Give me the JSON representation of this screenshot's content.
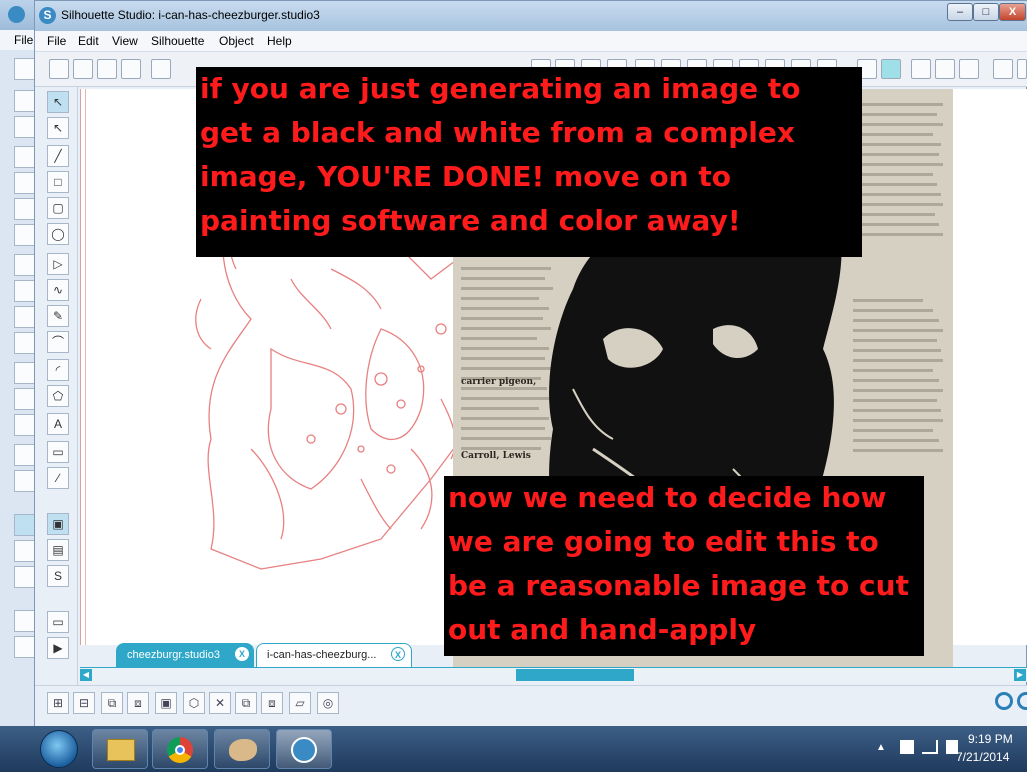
{
  "back_window": {
    "menu_label": "File"
  },
  "window": {
    "title": "Silhouette Studio: i-can-has-cheezburger.studio3",
    "logo_letter": "S",
    "minimize_label": "–",
    "maximize_label": "□",
    "close_label": "X"
  },
  "menu": {
    "items": [
      "File",
      "Edit",
      "View",
      "Silhouette",
      "Object",
      "Help"
    ]
  },
  "annotations": {
    "note_1": "if you are just generating an image to get a black and white from a complex image, YOU'RE DONE! move on to painting software and color away!",
    "note_2": "now we need to decide how we are going to edit this to be a reasonable image to cut out and hand-apply"
  },
  "tabs": [
    {
      "label": "cheezburgr.studio3",
      "close": "X",
      "active": true
    },
    {
      "label": "i-can-has-cheezburg...",
      "close": "X",
      "active": false
    }
  ],
  "scan_text": {
    "word_1": "Carroll, Lewis",
    "word_2": "carrier pigeon,"
  },
  "taskbar": {
    "time": "9:19 PM",
    "date": "7/21/2014"
  },
  "colors": {
    "accent": "#2ea7c9",
    "annotation_bg": "#000000",
    "annotation_text": "#ff1b1b",
    "trace_line": "#e88080"
  }
}
